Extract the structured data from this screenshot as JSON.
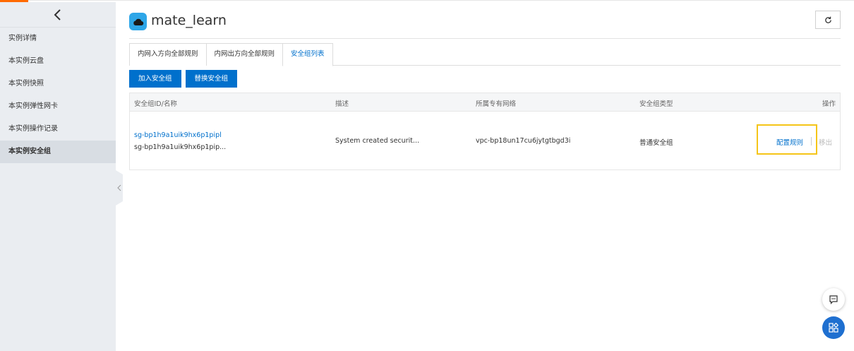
{
  "sidebar": {
    "items": [
      {
        "label": "实例详情",
        "active": false
      },
      {
        "label": "本实例云盘",
        "active": false
      },
      {
        "label": "本实例快照",
        "active": false
      },
      {
        "label": "本实例弹性网卡",
        "active": false
      },
      {
        "label": "本实例操作记录",
        "active": false
      },
      {
        "label": "本实例安全组",
        "active": true
      }
    ]
  },
  "header": {
    "title": "mate_learn",
    "icon": "cloud-icon"
  },
  "tabs": [
    {
      "label": "内网入方向全部规则",
      "active": false
    },
    {
      "label": "内网出方向全部规则",
      "active": false
    },
    {
      "label": "安全组列表",
      "active": true
    }
  ],
  "actions": {
    "add_label": "加入安全组",
    "replace_label": "替换安全组"
  },
  "table": {
    "headers": {
      "id_name": "安全组ID/名称",
      "description": "描述",
      "vpc": "所属专有网络",
      "type": "安全组类型",
      "operation": "操作"
    },
    "rows": [
      {
        "id": "sg-bp1h9a1uik9hx6p1pipl",
        "name": "sg-bp1h9a1uik9hx6p1pip...",
        "description": "System created securit...",
        "vpc": "vpc-bp18un17cu6jytgtbgd3i",
        "type": "普通安全组",
        "configure_label": "配置规则",
        "remove_label": "移出"
      }
    ]
  },
  "colors": {
    "accent": "#0070cc",
    "highlight": "#f5c518",
    "sidebar_bg": "#eaedf1"
  }
}
